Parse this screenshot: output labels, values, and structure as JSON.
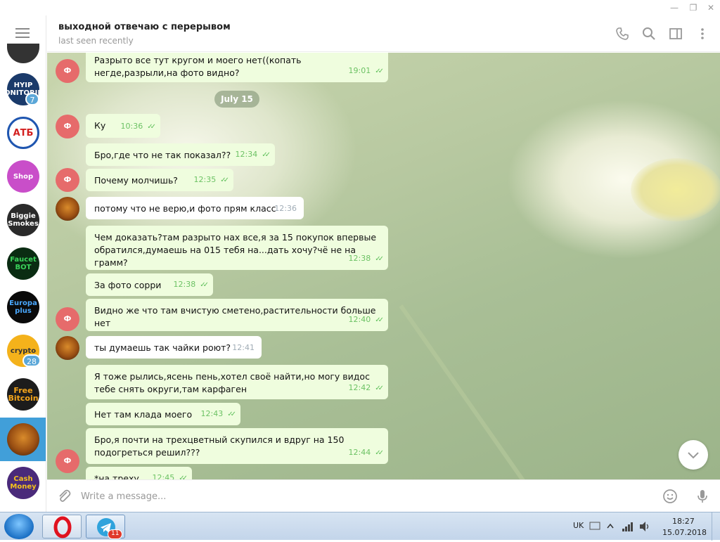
{
  "window": {
    "minimize": "—",
    "restore": "❐",
    "close": "✕"
  },
  "header": {
    "title": "выходной отвечаю с перерывом",
    "status": "last seen recently"
  },
  "sidebar": {
    "chats": [
      {
        "label": "HYIP MONITORING",
        "badge": "7",
        "color": "#1a3a6a"
      },
      {
        "label": "АТБ",
        "badge": "",
        "color": "#1f56b0"
      },
      {
        "label": "Shop",
        "badge": "",
        "color": "#c94ec9"
      },
      {
        "label": "Biggie Smokes",
        "badge": "",
        "color": "#2a2a2a"
      },
      {
        "label": "Faucet BOT",
        "badge": "",
        "color": "#0a2c12"
      },
      {
        "label": "Europa plus",
        "badge": "",
        "color": "#0a0a0a"
      },
      {
        "label": "crypto",
        "badge": "28",
        "color": "#f4b21b"
      },
      {
        "label": "Free Bitcoin",
        "badge": "",
        "color": "#1c1c1c"
      },
      {
        "label": "lion",
        "badge": "",
        "color": "#9a4f13"
      },
      {
        "label": "Cash Money",
        "badge": "",
        "color": "#4a2a7a"
      }
    ]
  },
  "chat": {
    "date_separator": "July 15",
    "sender_initial": "Ф",
    "messages": [
      {
        "dir": "out",
        "text": "Разрыто все тут кругом и моего нет((копать негде,разрыли,на фото видно?",
        "time": "19:01"
      },
      {
        "dir": "out",
        "text": "Ку",
        "time": "10:36"
      },
      {
        "dir": "out",
        "text": "Бро,где что не так показал??",
        "time": "12:34"
      },
      {
        "dir": "out",
        "text": "Почему молчишь?",
        "time": "12:35"
      },
      {
        "dir": "in",
        "text": "потому что не верю,и фото прям класс",
        "time": "12:36"
      },
      {
        "dir": "out",
        "text": "Чем доказать?там разрыто нах все,я за 15 покупок впервые обратился,думаешь на 015 тебя на...дать хочу?чё не на грамм?",
        "time": "12:38"
      },
      {
        "dir": "out",
        "text": "За фото сорри",
        "time": "12:38"
      },
      {
        "dir": "out",
        "text": "Видно же что там вчистую сметено,растительности больше нет",
        "time": "12:40"
      },
      {
        "dir": "in",
        "text": "ты думаешь так чайки роют?",
        "time": "12:41"
      },
      {
        "dir": "out",
        "text": "Я тоже рылись,ясень пень,хотел своё найти,но могу видос тебе снять округи,там карфаген",
        "time": "12:42"
      },
      {
        "dir": "out",
        "text": "Нет там клада моего",
        "time": "12:43"
      },
      {
        "dir": "out",
        "text": "Бро,я почти на трехцветный скупился и вдруг на 150 подогреться решил???",
        "time": "12:44"
      },
      {
        "dir": "out",
        "text": "*на треху",
        "time": "12:45"
      }
    ]
  },
  "compose": {
    "placeholder": "Write a message..."
  },
  "taskbar": {
    "telegram_badge": "11",
    "language": "UK",
    "time": "18:27",
    "date": "15.07.2018"
  }
}
